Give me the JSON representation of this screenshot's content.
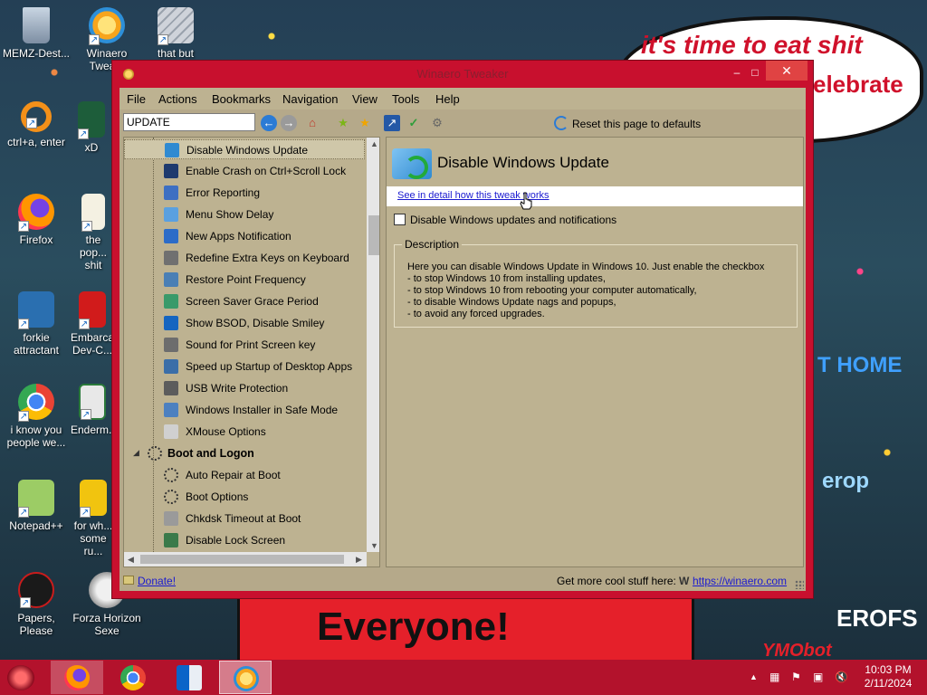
{
  "wallpaper": {
    "bubble_line1": "it's time to eat shit",
    "bubble_line2": "elebrate",
    "banner_text": "Everyone!",
    "sign_erop": "erop",
    "sign_erofs": "EROFS",
    "sign_home": "T HOME",
    "sign_wmobot": "YMObot"
  },
  "desktop_icons": [
    {
      "label": "MEMZ-Dest...",
      "icon": "recycle-bin-icon"
    },
    {
      "label": "Winaero Twea...",
      "icon": "winaero-icon"
    },
    {
      "label": "that but when...",
      "icon": "folder-stack-icon"
    },
    {
      "label": "ctrl+a, enter",
      "icon": "ring-icon"
    },
    {
      "label": "xD",
      "icon": "hx-icon"
    },
    {
      "label": "Firefox",
      "icon": "firefox-icon"
    },
    {
      "label": "the pop... shit",
      "icon": "document-icon"
    },
    {
      "label": "forkie attractant",
      "icon": "settings-monitor-icon"
    },
    {
      "label": "Embarca... Dev-C...",
      "icon": "devcpp-icon"
    },
    {
      "label": "i know you people we...",
      "icon": "chrome-icon"
    },
    {
      "label": "Enderm...",
      "icon": "window-icon"
    },
    {
      "label": "Notepad++",
      "icon": "notepadpp-icon"
    },
    {
      "label": "for wh... some ru...",
      "icon": "dc-icon"
    },
    {
      "label": "Papers, Please",
      "icon": "papers-please-icon"
    },
    {
      "label": "Forza Horizon Sexe",
      "icon": "flash-icon"
    }
  ],
  "window": {
    "title": "Winaero Tweaker",
    "close_glyph": "✕",
    "menu": [
      "File",
      "Actions",
      "Bookmarks",
      "Navigation",
      "View",
      "Tools",
      "Help"
    ],
    "search": {
      "value": "UPDATE"
    },
    "reset_label": "Reset this page to defaults",
    "tree": [
      {
        "label": "Disable Windows Update",
        "selected": true,
        "icon": "windows-update-icon",
        "color": "#2f8ad1"
      },
      {
        "label": "Enable Crash on Ctrl+Scroll Lock",
        "icon": "monitor-dark-icon",
        "color": "#1e3a6e"
      },
      {
        "label": "Error Reporting",
        "icon": "error-report-icon",
        "color": "#3d6fc2"
      },
      {
        "label": "Menu Show Delay",
        "icon": "menu-icon",
        "color": "#5aa0e0"
      },
      {
        "label": "New Apps Notification",
        "icon": "notification-icon",
        "color": "#2c6cc8"
      },
      {
        "label": "Redefine Extra Keys on Keyboard",
        "icon": "keyboard-icon",
        "color": "#707070"
      },
      {
        "label": "Restore Point Frequency",
        "icon": "restore-icon",
        "color": "#4a7fb5"
      },
      {
        "label": "Screen Saver Grace Period",
        "icon": "screensaver-icon",
        "color": "#3a9a6a"
      },
      {
        "label": "Show BSOD, Disable Smiley",
        "icon": "bsod-icon",
        "color": "#1565c0"
      },
      {
        "label": "Sound for Print Screen key",
        "icon": "sound-icon",
        "color": "#6d6d6d"
      },
      {
        "label": "Speed up Startup of Desktop Apps",
        "icon": "startup-icon",
        "color": "#3b6ea8"
      },
      {
        "label": "USB Write Protection",
        "icon": "usb-icon",
        "color": "#5c5c5c"
      },
      {
        "label": "Windows Installer in Safe Mode",
        "icon": "installer-icon",
        "color": "#4c80c0"
      },
      {
        "label": "XMouse Options",
        "icon": "mouse-icon",
        "color": "#d0d0d0"
      },
      {
        "label": "Boot and Logon",
        "group": true,
        "icon": "boot-group-icon",
        "color": "#8a8a8a"
      },
      {
        "label": "Auto Repair at Boot",
        "icon": "dots-spinner-icon",
        "color": "#bdb291"
      },
      {
        "label": "Boot Options",
        "icon": "dots-spinner-icon",
        "color": "#bdb291"
      },
      {
        "label": "Chkdsk Timeout at Boot",
        "icon": "disk-icon",
        "color": "#9a9a9a"
      },
      {
        "label": "Disable Lock Screen",
        "icon": "lock-screen-icon",
        "color": "#3a7a4a"
      }
    ],
    "details": {
      "title": "Disable Windows Update",
      "detail_link": "See in detail how this tweak works",
      "checkbox_label": "Disable Windows updates and notifications",
      "checkbox_checked": false,
      "description_legend": "Description",
      "description_lines": [
        "Here you can disable Windows Update in Windows 10. Just enable the checkbox",
        "- to stop Windows 10 from installing updates,",
        "- to stop Windows 10 from rebooting your computer automatically,",
        "- to disable Windows Update nags and popups,",
        "- to avoid any forced upgrades."
      ]
    },
    "status": {
      "donate": "Donate!",
      "more_text": "Get more cool stuff here:",
      "w_glyph": "W",
      "winaero_link": "https://winaero.com"
    }
  },
  "taskbar": {
    "apps": [
      {
        "name": "firefox",
        "icon": "firefox-icon",
        "active": true
      },
      {
        "name": "chrome",
        "icon": "chrome-icon",
        "active": false
      },
      {
        "name": "outlook",
        "icon": "outlook-icon",
        "active": false
      },
      {
        "name": "winaero-tweaker",
        "icon": "winaero-icon",
        "active": true,
        "highlighted": true
      }
    ],
    "time": "10:03 PM",
    "date": "2/11/2024"
  },
  "colors": {
    "window_frame": "#c8102e",
    "client_bg": "#b5a98a",
    "link": "#1a1ad0",
    "taskbar": "#b3122c"
  }
}
